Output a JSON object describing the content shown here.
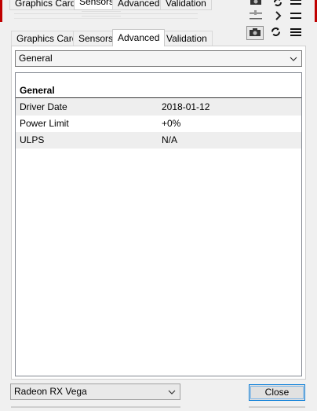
{
  "ghost_tabs": [
    "Graphics Card",
    "Sensors",
    "Advanced",
    "Validation"
  ],
  "tabs": [
    {
      "label": "Graphics Card",
      "active": false
    },
    {
      "label": "Sensors",
      "active": false
    },
    {
      "label": "Advanced",
      "active": true
    },
    {
      "label": "Validation",
      "active": false
    }
  ],
  "toolbar": {
    "icons": [
      "camera-icon",
      "refresh-icon",
      "menu-icon"
    ]
  },
  "category_select": {
    "value": "General"
  },
  "list": {
    "group": "General",
    "rows": [
      {
        "key": "Driver Date",
        "value": "2018-01-12"
      },
      {
        "key": "Power Limit",
        "value": "+0%"
      },
      {
        "key": "ULPS",
        "value": "N/A"
      }
    ]
  },
  "gpu_select": {
    "value": "Radeon RX Vega"
  },
  "close_button": {
    "label": "Close"
  },
  "colors": {
    "accent": "#0078d7",
    "window_border": "#c00000"
  }
}
